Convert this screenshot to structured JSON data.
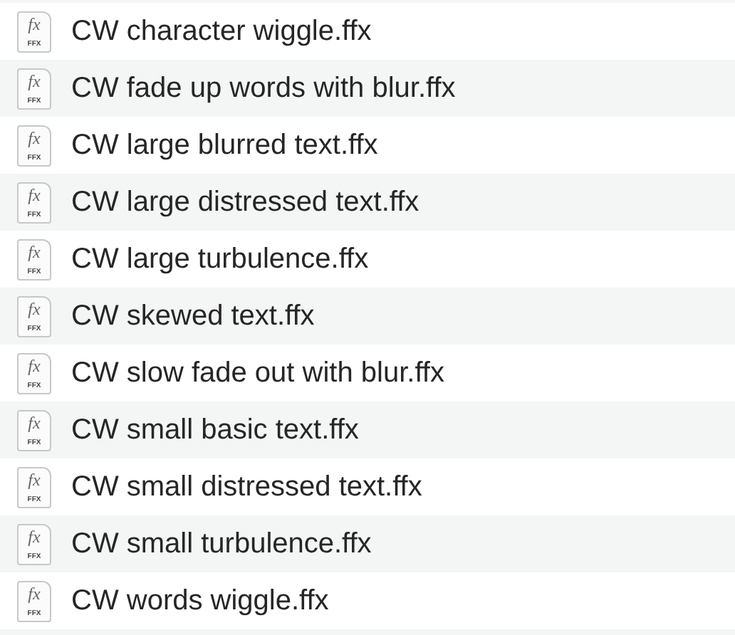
{
  "files": [
    {
      "name": "CW character wiggle.ffx",
      "icon_glyph": "fx",
      "icon_label": "FFX"
    },
    {
      "name": "CW fade up words with blur.ffx",
      "icon_glyph": "fx",
      "icon_label": "FFX"
    },
    {
      "name": "CW large blurred text.ffx",
      "icon_glyph": "fx",
      "icon_label": "FFX"
    },
    {
      "name": "CW large distressed text.ffx",
      "icon_glyph": "fx",
      "icon_label": "FFX"
    },
    {
      "name": "CW large turbulence.ffx",
      "icon_glyph": "fx",
      "icon_label": "FFX"
    },
    {
      "name": "CW skewed text.ffx",
      "icon_glyph": "fx",
      "icon_label": "FFX"
    },
    {
      "name": "CW slow fade out with blur.ffx",
      "icon_glyph": "fx",
      "icon_label": "FFX"
    },
    {
      "name": "CW small basic text.ffx",
      "icon_glyph": "fx",
      "icon_label": "FFX"
    },
    {
      "name": "CW small distressed text.ffx",
      "icon_glyph": "fx",
      "icon_label": "FFX"
    },
    {
      "name": "CW small turbulence.ffx",
      "icon_glyph": "fx",
      "icon_label": "FFX"
    },
    {
      "name": "CW words wiggle.ffx",
      "icon_glyph": "fx",
      "icon_label": "FFX"
    }
  ]
}
